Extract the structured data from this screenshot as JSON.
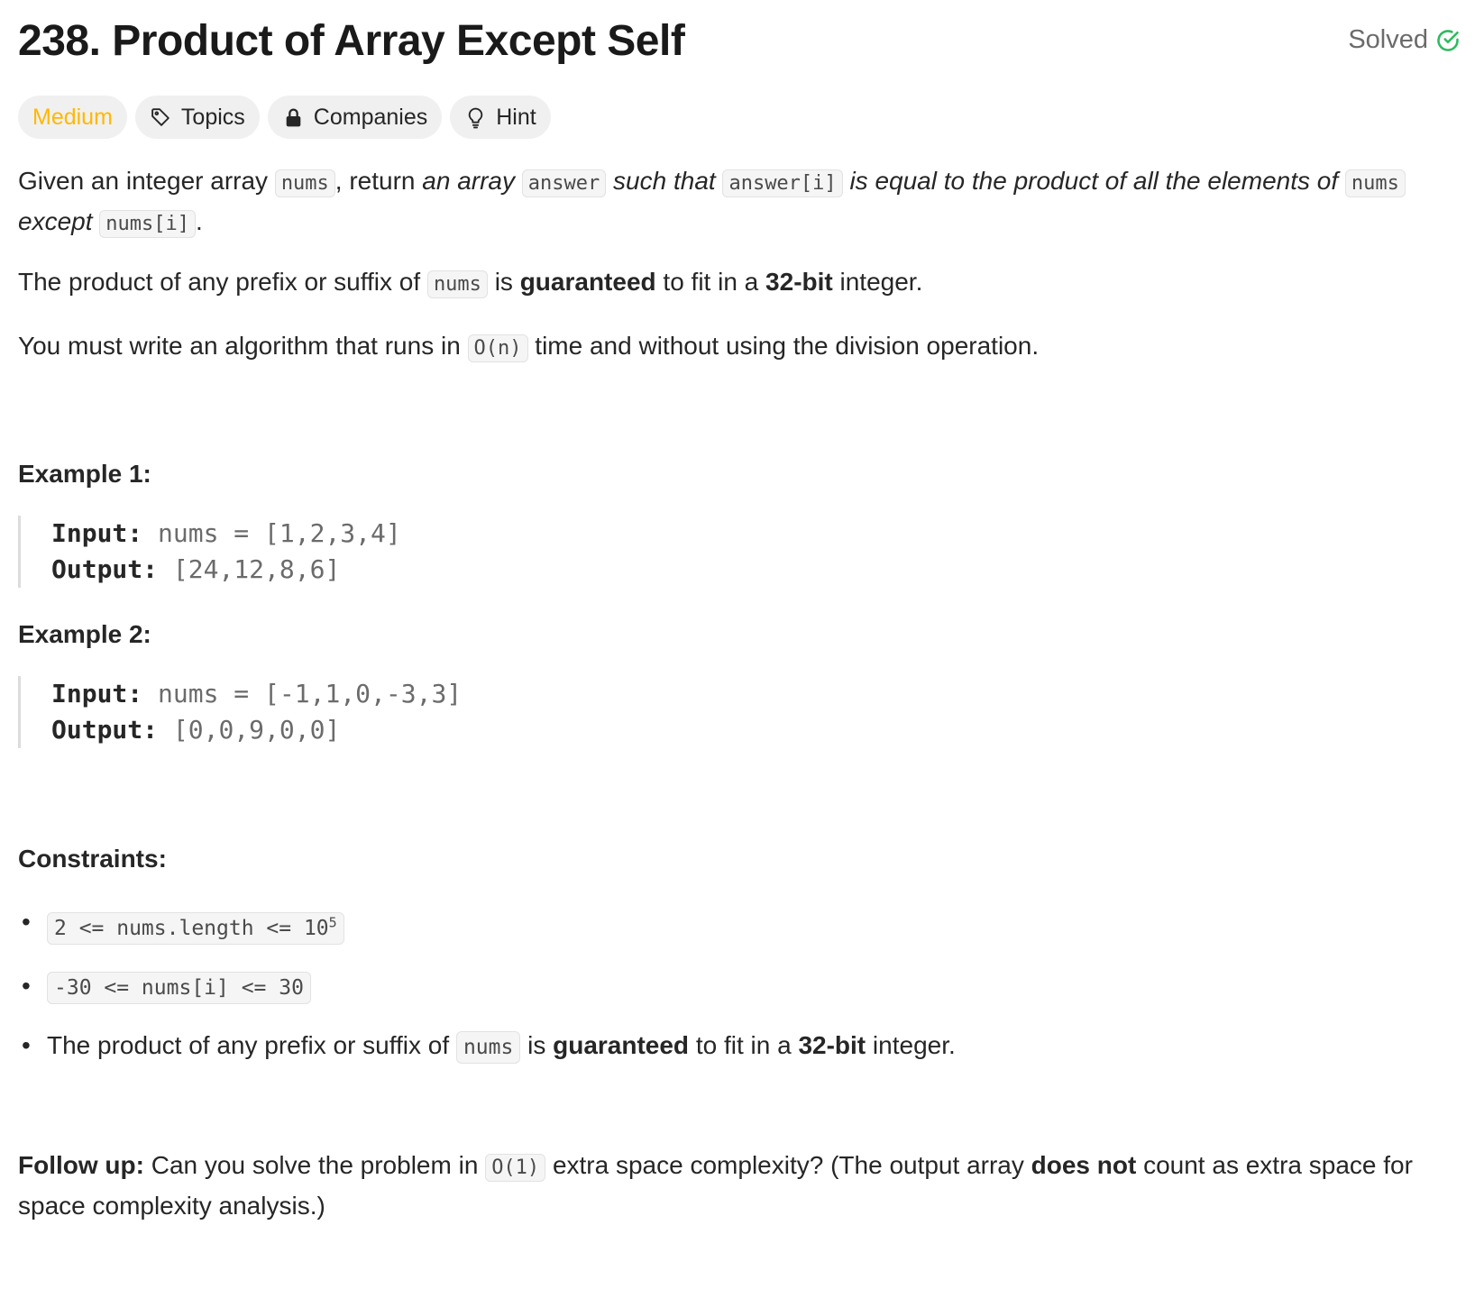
{
  "header": {
    "title": "238. Product of Array Except Self",
    "status": "Solved",
    "status_icon": "check-circle-icon",
    "status_color": "#2cbb5d"
  },
  "tags": {
    "difficulty": "Medium",
    "difficulty_color": "#ffb800",
    "topics": "Topics",
    "companies": "Companies",
    "hint": "Hint"
  },
  "description": {
    "p1": {
      "t1": "Given an integer array ",
      "c1": "nums",
      "t2": ", return ",
      "i1": "an array ",
      "c2": "answer",
      "i2": " such that ",
      "c3": "answer[i]",
      "i3": " is equal to the product of all the elements of ",
      "c4": "nums",
      "i4": " except ",
      "c5": "nums[i]",
      "t3": "."
    },
    "p2": {
      "t1": "The product of any prefix or suffix of ",
      "c1": "nums",
      "t2": " is ",
      "b1": "guaranteed",
      "t3": " to fit in a ",
      "b2": "32-bit",
      "t4": " integer."
    },
    "p3": {
      "t1": "You must write an algorithm that runs in ",
      "c1": "O(n)",
      "t2": " time and without using the division operation."
    }
  },
  "examples": [
    {
      "heading": "Example 1:",
      "input_label": "Input:",
      "input_value": "nums = [1,2,3,4]",
      "output_label": "Output:",
      "output_value": "[24,12,8,6]"
    },
    {
      "heading": "Example 2:",
      "input_label": "Input:",
      "input_value": "nums = [-1,1,0,-3,3]",
      "output_label": "Output:",
      "output_value": "[0,0,9,0,0]"
    }
  ],
  "constraints": {
    "heading": "Constraints:",
    "c1": {
      "code": "2 <= nums.length <= 10",
      "sup": "5"
    },
    "c2": {
      "code": "-30 <= nums[i] <= 30"
    },
    "c3": {
      "t1": "The product of any prefix or suffix of ",
      "c1": "nums",
      "t2": " is ",
      "b1": "guaranteed",
      "t3": " to fit in a ",
      "b2": "32-bit",
      "t4": " integer."
    }
  },
  "follow_up": {
    "label": "Follow up:",
    "t1": " Can you solve the problem in ",
    "c1": "O(1)",
    "t2": " extra space complexity? (The output array ",
    "b1": "does not",
    "t3": " count as extra space for space complexity analysis.)"
  }
}
